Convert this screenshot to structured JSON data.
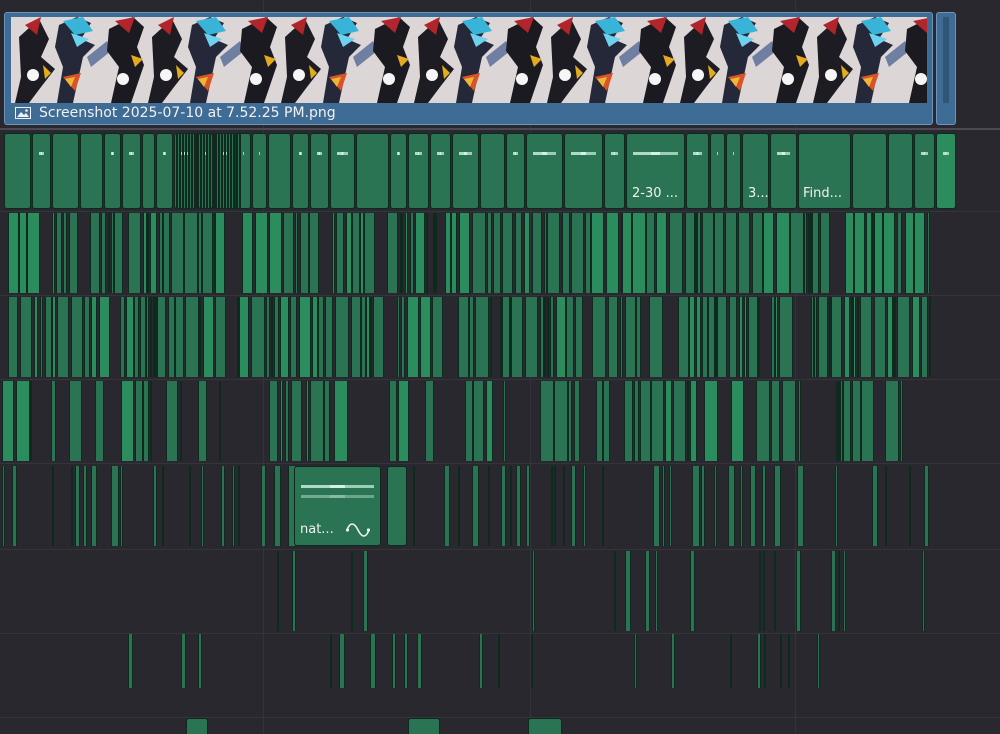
{
  "window": {
    "name": "video editor timeline"
  },
  "video_track": {
    "clip_label": "Screenshot 2025-07-10 at 7.52.25 PM.png",
    "icon": "image-icon",
    "clip_color": "#3f6c95"
  },
  "audio_track_1": {
    "labels": [
      "2-30 ...",
      "3...",
      "Find..."
    ]
  },
  "audio_track_5": {
    "label": "nat...",
    "icon": "keyframe-curve-icon"
  },
  "colors": {
    "audio_clip": "#2a7353",
    "audio_clip_bright": "#2b8c5e",
    "background": "#28282e"
  }
}
